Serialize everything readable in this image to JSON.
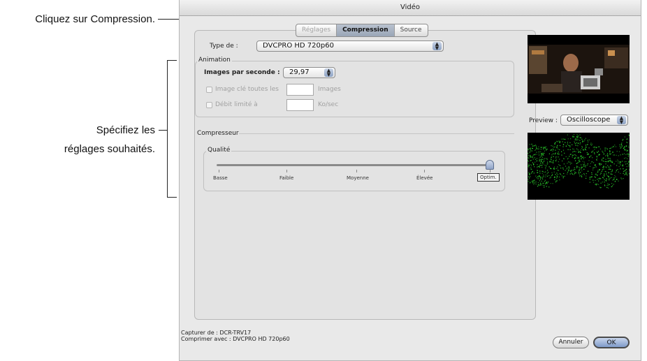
{
  "annotations": {
    "click_compression": "Cliquez sur Compression.",
    "specify_line1": "Spécifiez les",
    "specify_line2": "réglages souhaités."
  },
  "window": {
    "title": "Vidéo",
    "tabs": [
      {
        "label": "Réglages",
        "state": "disabled"
      },
      {
        "label": "Compression",
        "state": "selected"
      },
      {
        "label": "Source",
        "state": "normal"
      }
    ],
    "type_label": "Type de :",
    "type_value": "DVCPRO HD 720p60",
    "animation": {
      "title": "Animation",
      "fps_label": "Images par seconde :",
      "fps_value": "29,97",
      "keyframe_label": "Image clé toutes les",
      "keyframe_unit": "Images",
      "keyframe_value": "",
      "rate_label": "Débit limité à",
      "rate_unit": "Ko/sec",
      "rate_value": ""
    },
    "compressor": {
      "title": "Compresseur",
      "quality_title": "Qualité",
      "quality_ticks": [
        "Basse",
        "Faible",
        "Moyenne",
        "Élevée",
        "Optim."
      ],
      "quality_level": 1.0
    },
    "preview": {
      "label": "Preview :",
      "mode": "Oscilloscope"
    },
    "footer": {
      "capture": "Capturer de : DCR-TRV17",
      "compress": "Comprimer avec : DVCPRO HD 720p60"
    },
    "buttons": {
      "cancel": "Annuler",
      "ok": "OK"
    }
  },
  "colors": {
    "scope_green": "#2fe02f",
    "selected_tab": "#9aa6b7",
    "default_button": "#7f9bc9"
  }
}
